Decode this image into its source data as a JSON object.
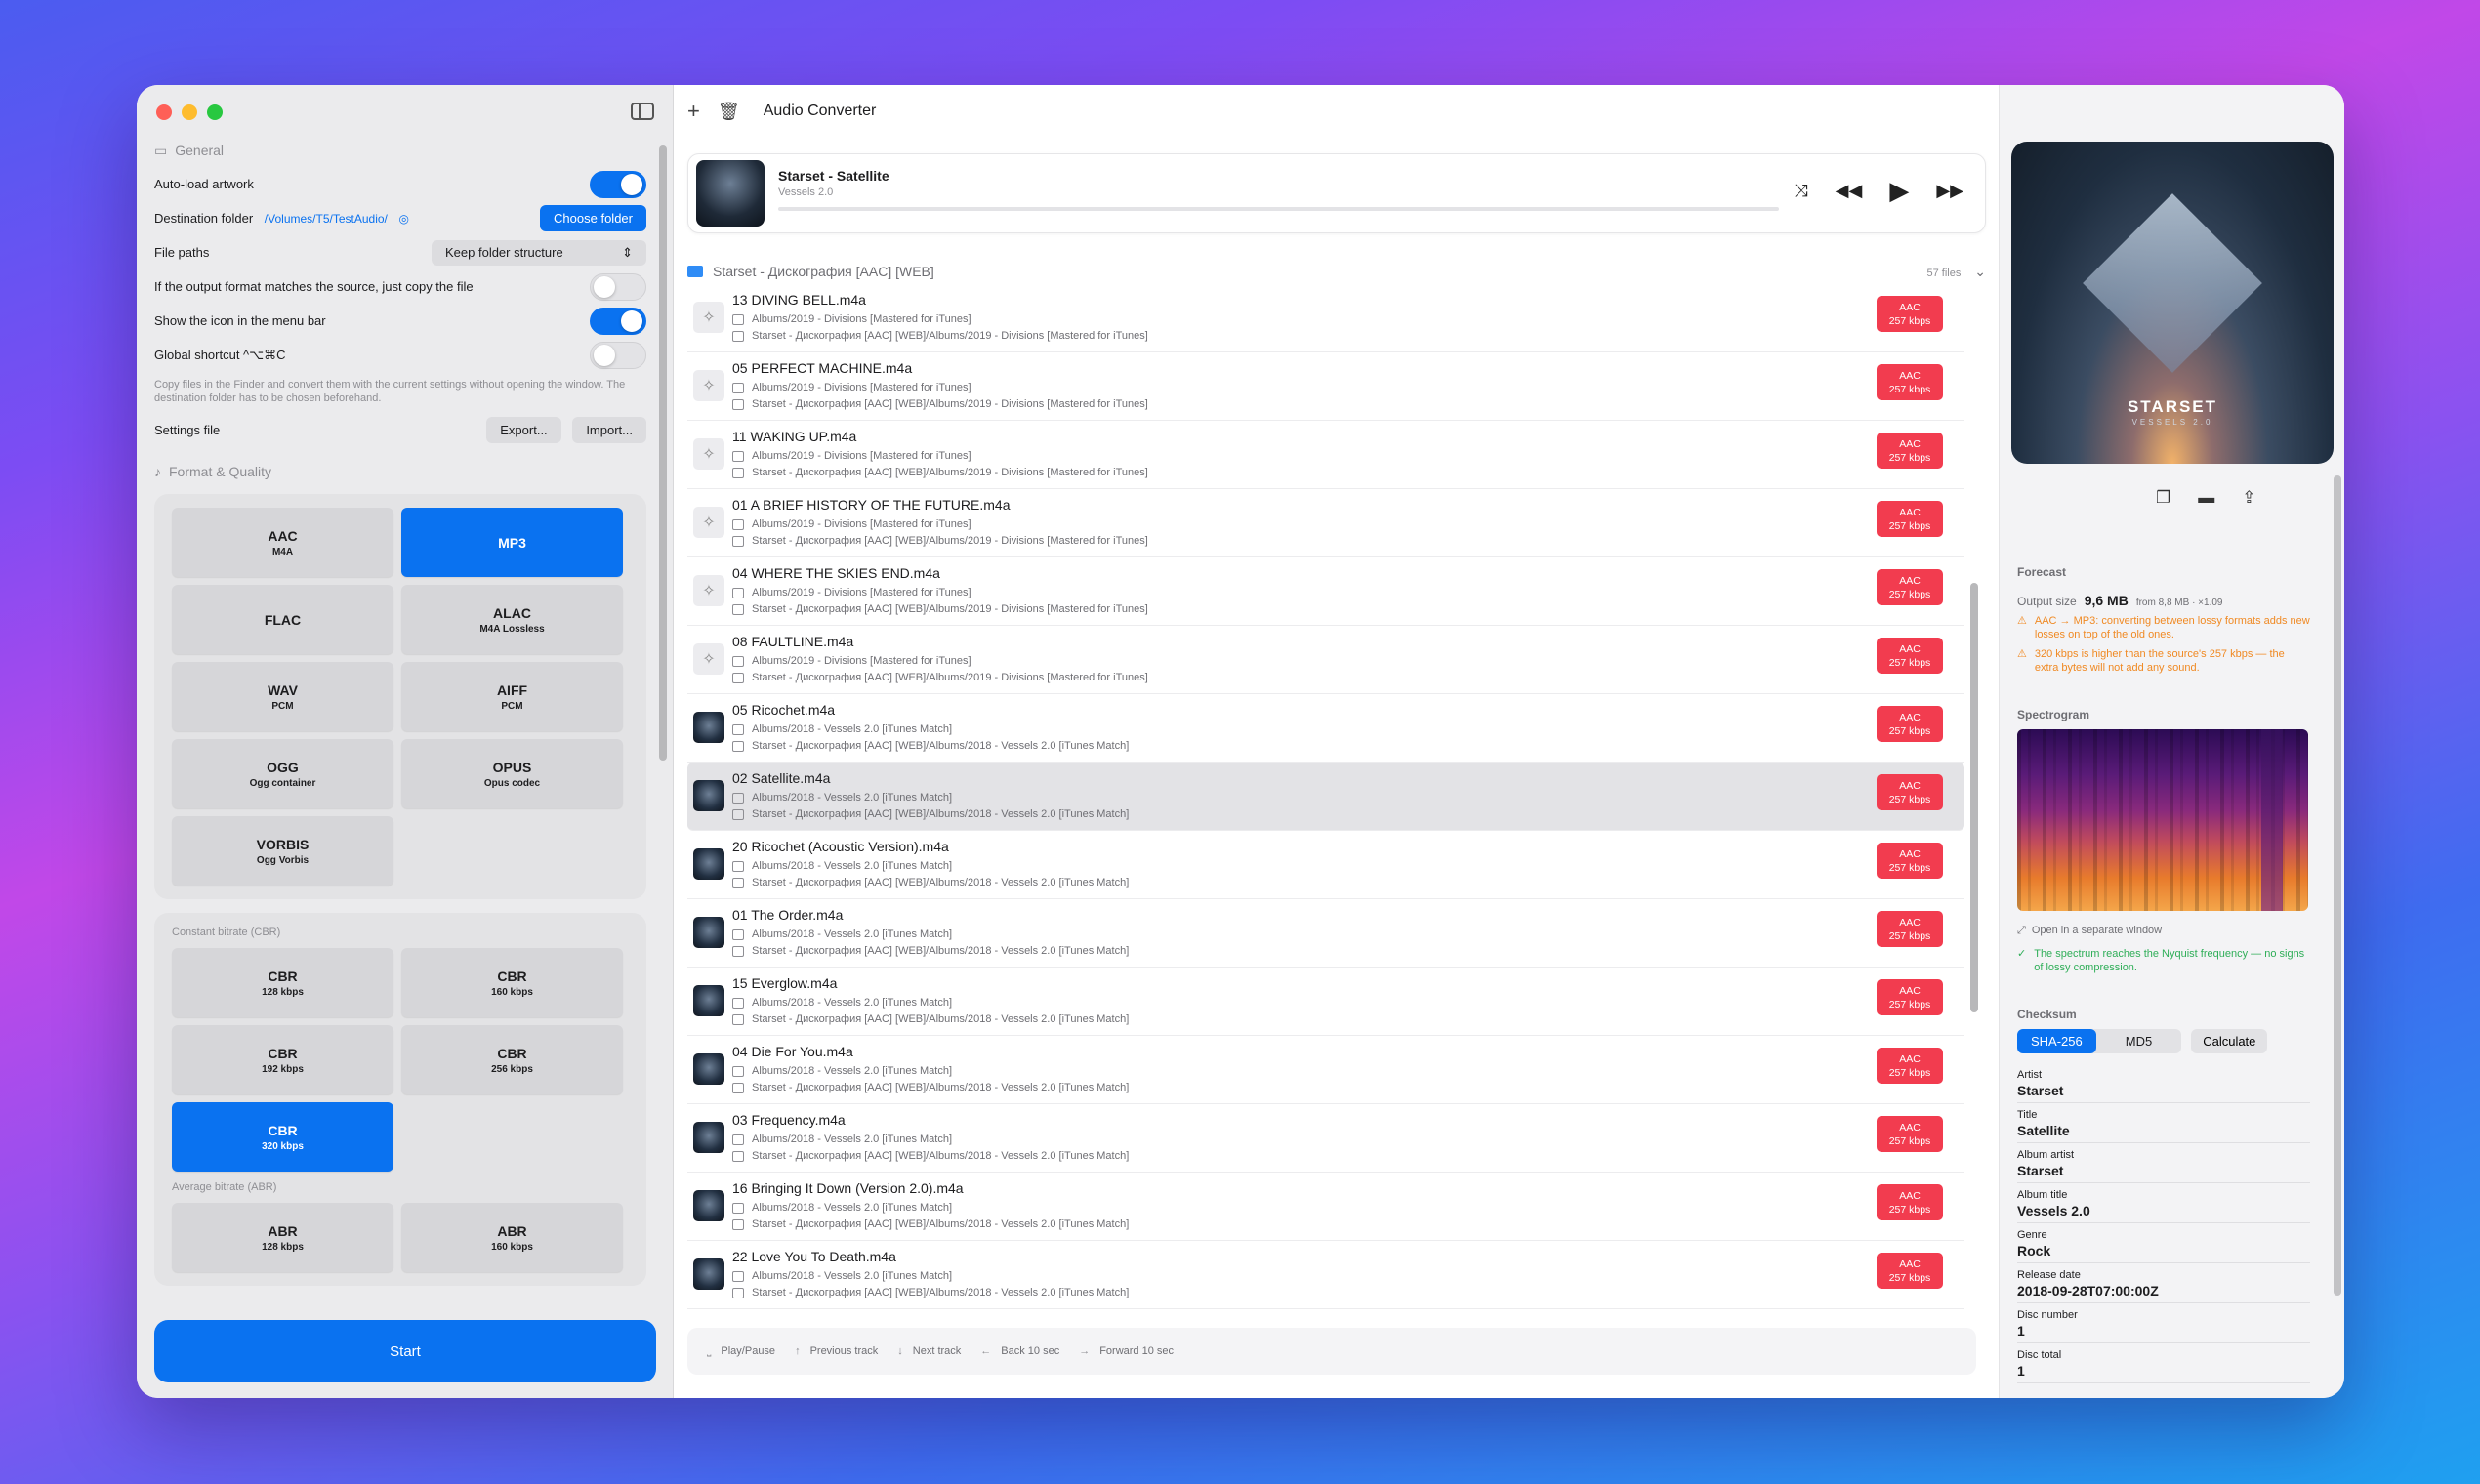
{
  "app": {
    "title": "Audio Converter"
  },
  "left": {
    "general_label": "General",
    "auto_load_artwork": "Auto-load artwork",
    "destination_folder": "Destination folder",
    "destination_path": "/Volumes/T5/TestAudio/",
    "choose_folder": "Choose folder",
    "file_paths": "File paths",
    "file_paths_value": "Keep folder structure",
    "copy_if_match": "If the output format matches the source, just copy the file",
    "show_icon": "Show the icon in the menu bar",
    "global_shortcut": "Global shortcut ^⌥⌘C",
    "hint": "Copy files in the Finder and convert them with the current settings without opening the window. The destination folder has to be chosen beforehand.",
    "settings_file": "Settings file",
    "export": "Export...",
    "import": "Import...",
    "format_quality": "Format & Quality",
    "formats": [
      {
        "name": "AAC",
        "sub": "M4A"
      },
      {
        "name": "MP3",
        "sub": ""
      },
      {
        "name": "FLAC",
        "sub": ""
      },
      {
        "name": "ALAC",
        "sub": "M4A Lossless"
      },
      {
        "name": "WAV",
        "sub": "PCM"
      },
      {
        "name": "AIFF",
        "sub": "PCM"
      },
      {
        "name": "OGG",
        "sub": "Ogg container"
      },
      {
        "name": "OPUS",
        "sub": "Opus codec"
      },
      {
        "name": "VORBIS",
        "sub": "Ogg Vorbis"
      }
    ],
    "cbr_label": "Constant bitrate (CBR)",
    "cbr": [
      {
        "name": "CBR",
        "sub": "128 kbps"
      },
      {
        "name": "CBR",
        "sub": "160 kbps"
      },
      {
        "name": "CBR",
        "sub": "192 kbps"
      },
      {
        "name": "CBR",
        "sub": "256 kbps"
      },
      {
        "name": "CBR",
        "sub": "320 kbps"
      }
    ],
    "abr_label": "Average bitrate (ABR)",
    "abr": [
      {
        "name": "ABR",
        "sub": "128 kbps"
      },
      {
        "name": "ABR",
        "sub": "160 kbps"
      }
    ],
    "start": "Start"
  },
  "player": {
    "title": "Starset - Satellite",
    "album": "Vessels 2.0"
  },
  "folder": {
    "name": "Starset - Дискография [AAC] [WEB]",
    "count": "57 files"
  },
  "tracks": [
    {
      "name": "13 DIVING BELL.m4a",
      "p1": "Albums/2019 - Divisions [Mastered for iTunes]",
      "p2": "Starset - Дискография [AAC] [WEB]/Albums/2019 - Divisions [Mastered for iTunes]",
      "thumb": "placeholder"
    },
    {
      "name": "05 PERFECT MACHINE.m4a",
      "p1": "Albums/2019 - Divisions [Mastered for iTunes]",
      "p2": "Starset - Дискография [AAC] [WEB]/Albums/2019 - Divisions [Mastered for iTunes]",
      "thumb": "placeholder"
    },
    {
      "name": "11 WAKING UP.m4a",
      "p1": "Albums/2019 - Divisions [Mastered for iTunes]",
      "p2": "Starset - Дискография [AAC] [WEB]/Albums/2019 - Divisions [Mastered for iTunes]",
      "thumb": "placeholder"
    },
    {
      "name": "01 A BRIEF HISTORY OF THE FUTURE.m4a",
      "p1": "Albums/2019 - Divisions [Mastered for iTunes]",
      "p2": "Starset - Дискография [AAC] [WEB]/Albums/2019 - Divisions [Mastered for iTunes]",
      "thumb": "placeholder"
    },
    {
      "name": "04 WHERE THE SKIES END.m4a",
      "p1": "Albums/2019 - Divisions [Mastered for iTunes]",
      "p2": "Starset - Дискография [AAC] [WEB]/Albums/2019 - Divisions [Mastered for iTunes]",
      "thumb": "placeholder"
    },
    {
      "name": "08 FAULTLINE.m4a",
      "p1": "Albums/2019 - Divisions [Mastered for iTunes]",
      "p2": "Starset - Дискография [AAC] [WEB]/Albums/2019 - Divisions [Mastered for iTunes]",
      "thumb": "placeholder"
    },
    {
      "name": "05 Ricochet.m4a",
      "p1": "Albums/2018 - Vessels 2.0 [iTunes Match]",
      "p2": "Starset - Дискография [AAC] [WEB]/Albums/2018 - Vessels 2.0 [iTunes Match]",
      "thumb": "art"
    },
    {
      "name": "02 Satellite.m4a",
      "p1": "Albums/2018 - Vessels 2.0 [iTunes Match]",
      "p2": "Starset - Дискография [AAC] [WEB]/Albums/2018 - Vessels 2.0 [iTunes Match]",
      "thumb": "art",
      "selected": true
    },
    {
      "name": "20 Ricochet (Acoustic Version).m4a",
      "p1": "Albums/2018 - Vessels 2.0 [iTunes Match]",
      "p2": "Starset - Дискография [AAC] [WEB]/Albums/2018 - Vessels 2.0 [iTunes Match]",
      "thumb": "art"
    },
    {
      "name": "01 The Order.m4a",
      "p1": "Albums/2018 - Vessels 2.0 [iTunes Match]",
      "p2": "Starset - Дискография [AAC] [WEB]/Albums/2018 - Vessels 2.0 [iTunes Match]",
      "thumb": "art"
    },
    {
      "name": "15 Everglow.m4a",
      "p1": "Albums/2018 - Vessels 2.0 [iTunes Match]",
      "p2": "Starset - Дискография [AAC] [WEB]/Albums/2018 - Vessels 2.0 [iTunes Match]",
      "thumb": "art"
    },
    {
      "name": "04 Die For You.m4a",
      "p1": "Albums/2018 - Vessels 2.0 [iTunes Match]",
      "p2": "Starset - Дискография [AAC] [WEB]/Albums/2018 - Vessels 2.0 [iTunes Match]",
      "thumb": "art"
    },
    {
      "name": "03 Frequency.m4a",
      "p1": "Albums/2018 - Vessels 2.0 [iTunes Match]",
      "p2": "Starset - Дискография [AAC] [WEB]/Albums/2018 - Vessels 2.0 [iTunes Match]",
      "thumb": "art"
    },
    {
      "name": "16 Bringing It Down (Version 2.0).m4a",
      "p1": "Albums/2018 - Vessels 2.0 [iTunes Match]",
      "p2": "Starset - Дискография [AAC] [WEB]/Albums/2018 - Vessels 2.0 [iTunes Match]",
      "thumb": "art"
    },
    {
      "name": "22 Love You To Death.m4a",
      "p1": "Albums/2018 - Vessels 2.0 [iTunes Match]",
      "p2": "Starset - Дискография [AAC] [WEB]/Albums/2018 - Vessels 2.0 [iTunes Match]",
      "thumb": "art"
    }
  ],
  "badge": {
    "codec": "AAC",
    "bitrate": "257 kbps"
  },
  "shortcuts": [
    {
      "key": "⎵",
      "label": "Play/Pause"
    },
    {
      "key": "↑",
      "label": "Previous track"
    },
    {
      "key": "↓",
      "label": "Next track"
    },
    {
      "key": "←",
      "label": "Back 10 sec"
    },
    {
      "key": "→",
      "label": "Forward 10 sec"
    }
  ],
  "right": {
    "cover_brand": "STARSET",
    "cover_sub": "VESSELS 2.0",
    "forecast": "Forecast",
    "output_size_label": "Output size",
    "output_size": "9,6 MB",
    "output_from": "from 8,8 MB · ×1.09",
    "warn1": "AAC → MP3: converting between lossy formats adds new losses on top of the old ones.",
    "warn2": "320 kbps is higher than the source's 257 kbps — the extra bytes will not add any sound.",
    "spectrogram": "Spectrogram",
    "open_window": "Open in a separate window",
    "nyquist": "The spectrum reaches the Nyquist frequency — no signs of lossy compression.",
    "checksum": "Checksum",
    "sha": "SHA-256",
    "md5": "MD5",
    "calculate": "Calculate",
    "meta": [
      {
        "label": "Artist",
        "value": "Starset"
      },
      {
        "label": "Title",
        "value": "Satellite"
      },
      {
        "label": "Album artist",
        "value": "Starset"
      },
      {
        "label": "Album title",
        "value": "Vessels 2.0"
      },
      {
        "label": "Genre",
        "value": "Rock"
      },
      {
        "label": "Release date",
        "value": "2018-09-28T07:00:00Z"
      },
      {
        "label": "Disc number",
        "value": "1"
      },
      {
        "label": "Disc total",
        "value": "1"
      }
    ]
  },
  "colors": {
    "accent": "#0a72f0",
    "badge": "#f23c4f",
    "warning": "#f08a24",
    "success": "#2fae58"
  }
}
